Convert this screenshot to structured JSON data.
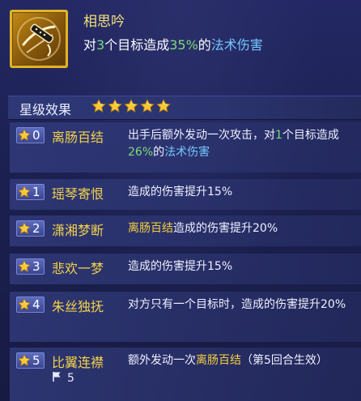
{
  "skill": {
    "name": "相思吟",
    "desc": {
      "pre": "对",
      "count": "3",
      "mid": "个目标造成",
      "percent": "35%",
      "post": "的",
      "type": "法术伤害"
    }
  },
  "section": {
    "title": "星级效果",
    "stars": 5
  },
  "rows": [
    {
      "level": "0",
      "name": "离肠百结",
      "parts": [
        {
          "t": "出手后额外发动一次攻击，对",
          "c": ""
        },
        {
          "t": "1",
          "c": "g"
        },
        {
          "t": "个目标造成",
          "c": ""
        },
        {
          "t": "26%",
          "c": "g"
        },
        {
          "t": "的",
          "c": ""
        },
        {
          "t": "法术伤害",
          "c": "b"
        }
      ]
    },
    {
      "level": "1",
      "name": "瑶琴寄恨",
      "parts": [
        {
          "t": "造成的伤害提升15%",
          "c": ""
        }
      ]
    },
    {
      "level": "2",
      "name": "潇湘梦断",
      "parts": [
        {
          "t": "离肠百结",
          "c": "y"
        },
        {
          "t": "造成的伤害提升20%",
          "c": ""
        }
      ]
    },
    {
      "level": "3",
      "name": "悲欢一梦",
      "parts": [
        {
          "t": "造成的伤害提升15%",
          "c": ""
        }
      ]
    },
    {
      "level": "4",
      "name": "朱丝独抚",
      "parts": [
        {
          "t": "对方只有一个目标时，造成的伤害提升20%",
          "c": ""
        }
      ]
    },
    {
      "level": "5",
      "name": "比翼连襟",
      "parts": [
        {
          "t": "额外发动一次",
          "c": ""
        },
        {
          "t": "离肠百结",
          "c": "y"
        },
        {
          "t": "（第5回合生效）",
          "c": ""
        }
      ],
      "flag_count": "5"
    }
  ],
  "colors": {
    "gold": "#f3d24a",
    "green": "#7ddc7a",
    "blue": "#74c8ff"
  },
  "icons": {
    "skill": "flute-weapon-icon",
    "star": "star-icon",
    "flag": "flag-icon"
  }
}
